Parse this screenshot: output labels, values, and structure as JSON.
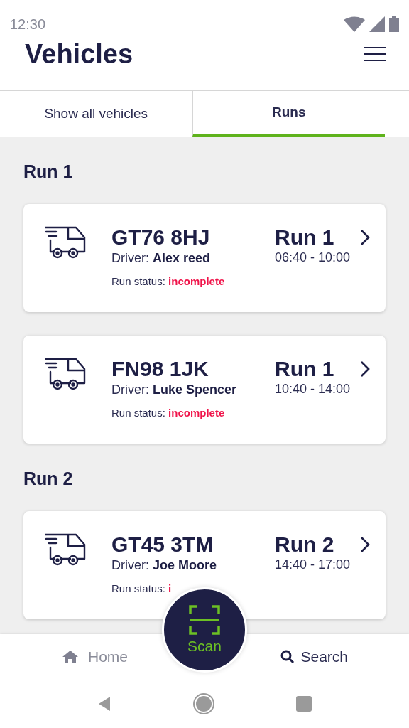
{
  "status_bar": {
    "time": "12:30"
  },
  "header": {
    "title": "Vehicles"
  },
  "tabs": [
    {
      "label": "Show all vehicles",
      "selected": false
    },
    {
      "label": "Runs",
      "selected": true
    }
  ],
  "sections": [
    {
      "title": "Run 1",
      "vehicles": [
        {
          "plate": "GT76 8HJ",
          "driver_label": "Driver:",
          "driver": "Alex reed",
          "status_label": "Run status:",
          "status": "incomplete",
          "run": "Run 1",
          "time": "06:40 - 10:00"
        },
        {
          "plate": "FN98 1JK",
          "driver_label": "Driver:",
          "driver": "Luke Spencer",
          "status_label": "Run status:",
          "status": "incomplete",
          "run": "Run 1",
          "time": "10:40 - 14:00"
        }
      ]
    },
    {
      "title": "Run 2",
      "vehicles": [
        {
          "plate": "GT45 3TM",
          "driver_label": "Driver:",
          "driver": "Joe Moore",
          "status_label": "Run status:",
          "status": "i",
          "run": "Run 2",
          "time": "14:40 - 17:00"
        }
      ]
    }
  ],
  "bottom_nav": {
    "home": "Home",
    "scan": "Scan",
    "search": "Search"
  }
}
